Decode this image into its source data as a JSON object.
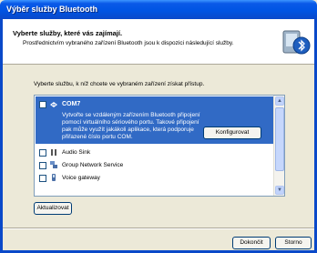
{
  "window": {
    "title": "Výběr služby Bluetooth"
  },
  "header": {
    "title": "Vyberte služby, které vás zajímají.",
    "subtitle": "Prostřednictvím vybraného zařízení Bluetooth jsou k dispozici následující služby."
  },
  "intro": "Vyberte službu, k níž chcete ve vybraném zařízení získat přístup.",
  "services": [
    {
      "name": "COM7",
      "description": "Vytvořte se vzdáleným zařízením Bluetooth připojení pomocí virtuálního sériového portu. Takové připojení pak může využít jakákoli aplikace, která podporuje přiřazené číslo portu COM.",
      "checked": false,
      "selected": true,
      "icon": "serial-port-icon"
    },
    {
      "name": "Audio Sink",
      "checked": false,
      "icon": "speaker-icon"
    },
    {
      "name": "Group Network Service",
      "checked": false,
      "icon": "network-icon"
    },
    {
      "name": "Voice gateway",
      "checked": false,
      "icon": "phone-icon"
    }
  ],
  "buttons": {
    "configure": "Konfigurovat",
    "refresh": "Aktualizovat",
    "finish": "Dokončit",
    "cancel": "Storno"
  },
  "colors": {
    "titlebar": "#0054e3",
    "selection": "#316ac5",
    "dialog": "#ece9d8"
  }
}
